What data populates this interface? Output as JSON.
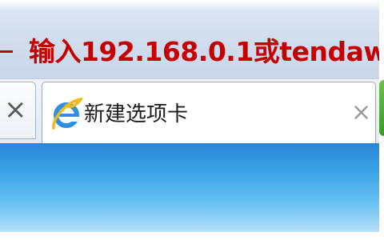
{
  "annotation": {
    "text": "输入192.168.0.1或tendaw",
    "color": "#c40000"
  },
  "tabs": {
    "previous": {
      "close_glyph": "×"
    },
    "active": {
      "icon": "ie-icon",
      "label": "新建选项卡",
      "close_glyph": "×"
    },
    "next": {
      "icon": "green-tab-edge"
    }
  },
  "colors": {
    "content_top": "#2a86d6",
    "content_bottom": "#b7e0f8",
    "tab_bar": "#e3e9f2"
  }
}
